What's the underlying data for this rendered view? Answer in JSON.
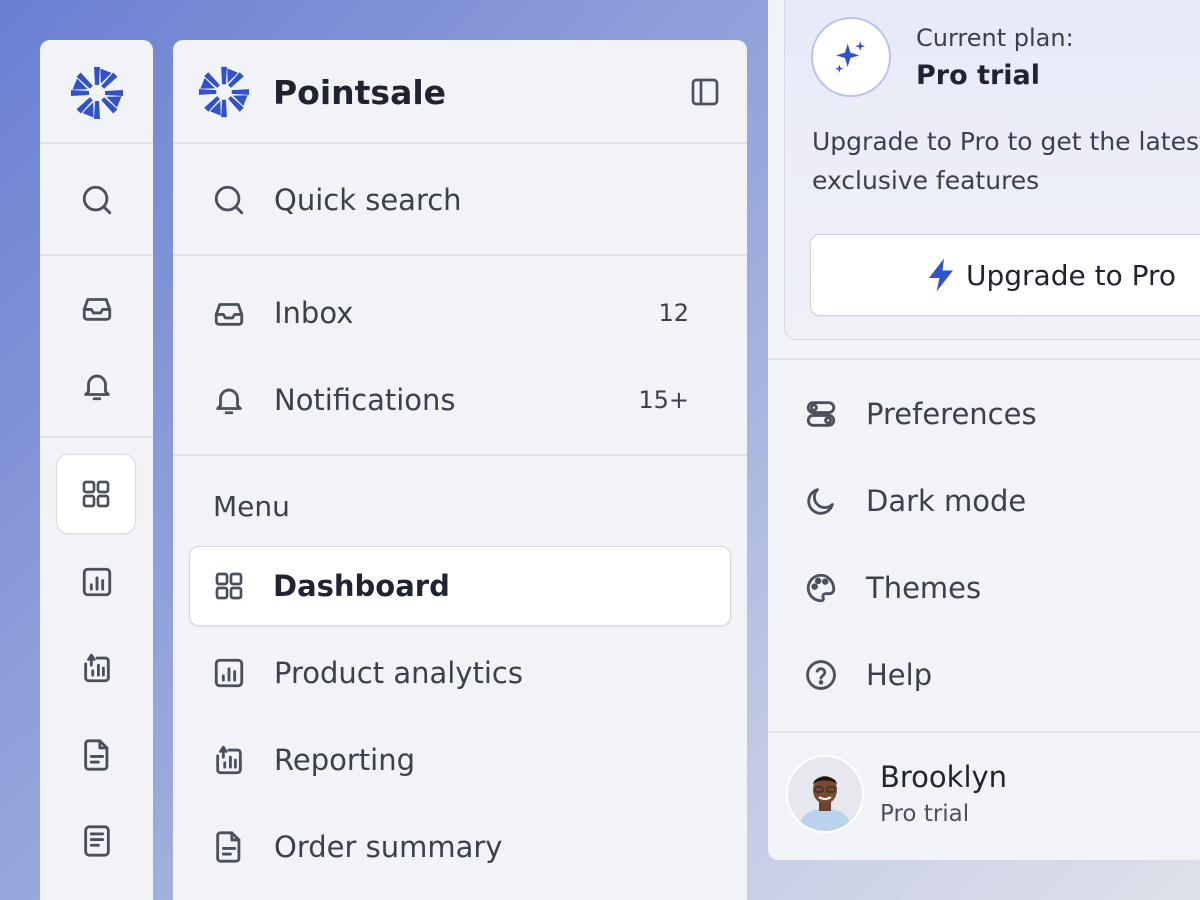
{
  "brand": {
    "name": "Pointsale",
    "accent": "#3452c8"
  },
  "rail": {
    "icons": [
      "logo-icon",
      "search-icon",
      "inbox-icon",
      "bell-icon",
      "dashboard-icon",
      "analytics-icon",
      "reporting-icon",
      "order-summary-icon",
      "document-icon"
    ]
  },
  "sidebar": {
    "search_label": "Quick search",
    "inbox": {
      "label": "Inbox",
      "count": "12"
    },
    "notifications": {
      "label": "Notifications",
      "count": "15+"
    },
    "menu_heading": "Menu",
    "items": [
      {
        "label": "Dashboard",
        "icon": "dashboard-icon",
        "active": true
      },
      {
        "label": "Product analytics",
        "icon": "analytics-icon"
      },
      {
        "label": "Reporting",
        "icon": "reporting-icon"
      },
      {
        "label": "Order summary",
        "icon": "order-summary-icon"
      }
    ]
  },
  "plan": {
    "label": "Current plan:",
    "name": "Pro trial",
    "description": "Upgrade to Pro to get the latest and\nexclusive features",
    "button": "Upgrade to Pro"
  },
  "settings": [
    {
      "label": "Preferences",
      "icon": "toggles-icon"
    },
    {
      "label": "Dark mode",
      "icon": "moon-icon"
    },
    {
      "label": "Themes",
      "icon": "palette-icon"
    },
    {
      "label": "Help",
      "icon": "help-icon"
    }
  ],
  "user": {
    "name": "Brooklyn",
    "plan": "Pro trial"
  }
}
